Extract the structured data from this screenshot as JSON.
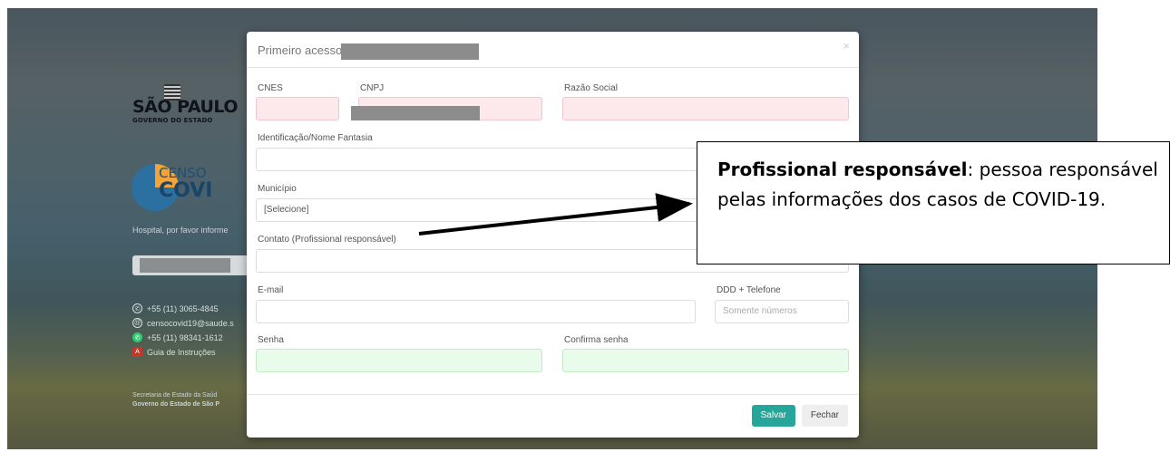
{
  "background": {
    "logo_main": "SÃO PAULO",
    "logo_sub": "GOVERNO DO ESTADO",
    "censo_line1": "CENSO",
    "censo_line2": "COVI",
    "prompt_text": "Hospital, por favor informe",
    "contacts": [
      {
        "icon": "phone-icon",
        "text": "+55 (11) 3065-4845"
      },
      {
        "icon": "email-icon",
        "text": "censocovid19@saude.s"
      },
      {
        "icon": "whatsapp-icon",
        "text": "+55 (11) 98341-1612"
      },
      {
        "icon": "pdf-icon",
        "text": "Guia de Instruções"
      }
    ],
    "footer_line1": "Secretaria de Estado da Saúd",
    "footer_line2": "Governo do Estado de São P"
  },
  "modal": {
    "title": "Primeiro acesso",
    "close_symbol": "×",
    "labels": {
      "cnes": "CNES",
      "cnpj": "CNPJ",
      "razao_social": "Razão Social",
      "identificacao": "Identificação/Nome Fantasia",
      "municipio": "Município",
      "contato": "Contato (Profissional responsável)",
      "email": "E-mail",
      "ddd_telefone": "DDD + Telefone",
      "senha": "Senha",
      "confirma_senha": "Confirma senha"
    },
    "values": {
      "municipio": "[Selecione]"
    },
    "placeholders": {
      "telefone": "Somente números"
    },
    "buttons": {
      "save": "Salvar",
      "close": "Fechar"
    }
  },
  "callout": {
    "bold": "Profissional responsável",
    "rest": ": pessoa responsável pelas informações dos casos de COVID-19."
  },
  "colors": {
    "required_pink": "#fde9ec",
    "valid_green": "#e9fbea",
    "save_button": "#26a69a"
  }
}
